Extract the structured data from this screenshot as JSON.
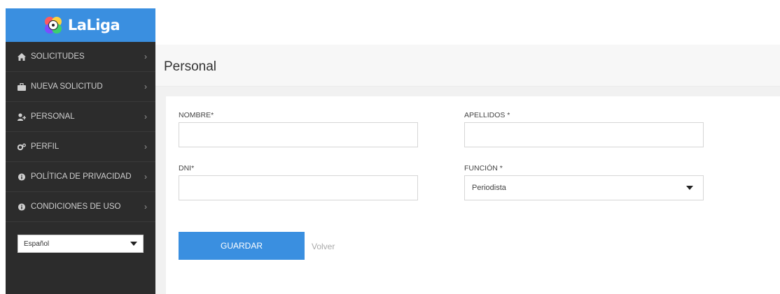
{
  "brand": {
    "name": "LaLiga"
  },
  "sidebar": {
    "items": [
      {
        "label": "SOLICITUDES",
        "icon": "home-icon"
      },
      {
        "label": "NUEVA SOLICITUD",
        "icon": "briefcase-icon"
      },
      {
        "label": "PERSONAL",
        "icon": "add-user-icon"
      },
      {
        "label": "PERFIL",
        "icon": "gears-icon"
      },
      {
        "label": "POLÍTICA DE PRIVACIDAD",
        "icon": "info-circle-icon"
      },
      {
        "label": "CONDICIONES DE USO",
        "icon": "info-circle-icon"
      }
    ],
    "chevron": "›",
    "language": {
      "value": "Español"
    }
  },
  "header": {
    "title": "Personal"
  },
  "form": {
    "nombre_label": "NOMBRE*",
    "nombre_value": "",
    "apellidos_label": "APELLIDOS *",
    "apellidos_value": "",
    "dni_label": "DNI*",
    "dni_value": "",
    "funcion_label": "FUNCIÓN *",
    "funcion_value": "Periodista",
    "save_label": "GUARDAR",
    "back_label": "Volver"
  },
  "colors": {
    "accent": "#3a8fe0",
    "sidebar_bg": "#2c2c2c",
    "sidebar_text": "#cfcfcf"
  }
}
